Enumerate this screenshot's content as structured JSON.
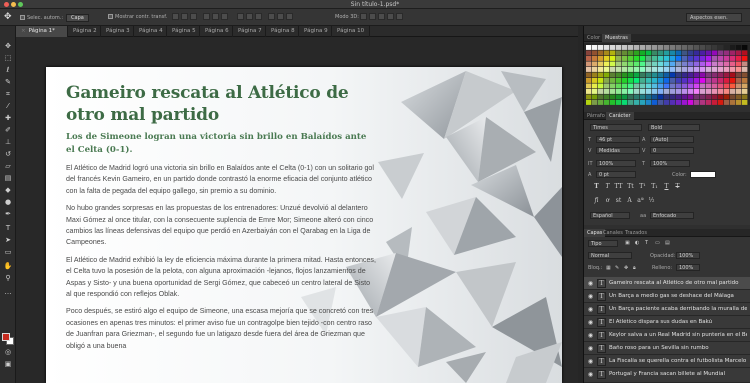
{
  "window": {
    "title": "Sin título-1.psd*"
  },
  "options": {
    "select_auto_label": "Selec. autom.:",
    "select_auto_value": "Capa",
    "transform_label": "Mostrar contr. transf.",
    "mode3d": "Modo 3D:",
    "workspace": "Aspectos esen."
  },
  "tabs": [
    {
      "label": "Página 1*"
    },
    {
      "label": "Página 2"
    },
    {
      "label": "Página 3"
    },
    {
      "label": "Página 4"
    },
    {
      "label": "Página 5"
    },
    {
      "label": "Página 6"
    },
    {
      "label": "Página 7"
    },
    {
      "label": "Página 8"
    },
    {
      "label": "Página 9"
    },
    {
      "label": "Página 10"
    }
  ],
  "article": {
    "headline": "Gameiro rescata al Atlético de otro mal partido",
    "subhead": "Los de Simeone logran una victoria sin brillo en Balaídos ante el Celta (0-1).",
    "paragraphs": [
      "El Atlético de Madrid logró una victoria sin brillo en Balaídos ante el Celta (0-1) con un solitario gol del francés Kevin Gameiro, en un partido donde contrastó la enorme eficacia del conjunto atlético con la falta de pegada del equipo gallego, sin premio a su dominio.",
      "No hubo grandes sorpresas en las propuestas de los entrenadores: Unzué devolvió al delantero Maxi Gómez al once titular, con la consecuente suplencia de Emre Mor; Simeone alteró con cinco cambios las líneas defensivas del equipo que perdió en Azerbaiyán con el Qarabag en la Liga de Campeones.",
      "El Atlético de Madrid exhibió la ley de eficiencia máxima durante la primera mitad. Hasta entonces, el Celta tuvo la posesión de la pelota, con alguna aproximación -lejanos, flojos lanzamientos de Aspas y Sisto- y una buena oportunidad de Sergi Gómez, que cabeceó un centro lateral de Sisto al que respondió con reflejos Oblak.",
      "Poco después, se estiró algo el equipo de Simeone, una escasa mejoría que se concretó con tres ocasiones en apenas tres minutos: el primer aviso fue un contragolpe bien tejido -con centro raso de Juanfran para Griezman-, el segundo fue un latigazo desde fuera del área de Griezman que obligó a una buena"
    ]
  },
  "panels": {
    "color_tabs": [
      "Color",
      "Muestras"
    ],
    "char_tabs": [
      "Párrafo",
      "Carácter"
    ],
    "font_family": "Times",
    "font_style": "Bold",
    "font_size": "46 pt",
    "leading": "(Auto)",
    "kerning": "Medidas",
    "tracking": "0",
    "vscale": "100%",
    "hscale": "100%",
    "baseline": "0 pt",
    "color_label": "Color:",
    "language": "Español",
    "aa_icon": "aa",
    "antialias": "Enfocado",
    "layers_tabs": [
      "Capas",
      "Canales",
      "Trazados"
    ],
    "filter_label": "Tipo",
    "blend_mode": "Normal",
    "opacity_label": "Opacidad:",
    "opacity_value": "100%",
    "lock_label": "Bloq.:",
    "fill_label": "Relleno:",
    "fill_value": "100%"
  },
  "layers": [
    {
      "name": "Gameiro rescata al Atlético de otro mal partido",
      "selected": true
    },
    {
      "name": "Un Barça a medio gas se deshace del Málaga"
    },
    {
      "name": "Un Barça paciente acaba derribando la muralla defensiva"
    },
    {
      "name": "El Atlético dispara sus dudas en Bakú"
    },
    {
      "name": "Keylor salva a un Real Madrid sin puntería en el Bernabéu"
    },
    {
      "name": "Baño roso para un Sevilla sin rumbo"
    },
    {
      "name": "La Fiscalía se querella contra el futbolista Marcelo por un"
    },
    {
      "name": "Portugal y Francia sacan billete al Mundial"
    }
  ],
  "icons": {
    "move": "move-tool-icon",
    "eye": "eye-icon",
    "text_layer": "text-layer-icon"
  }
}
